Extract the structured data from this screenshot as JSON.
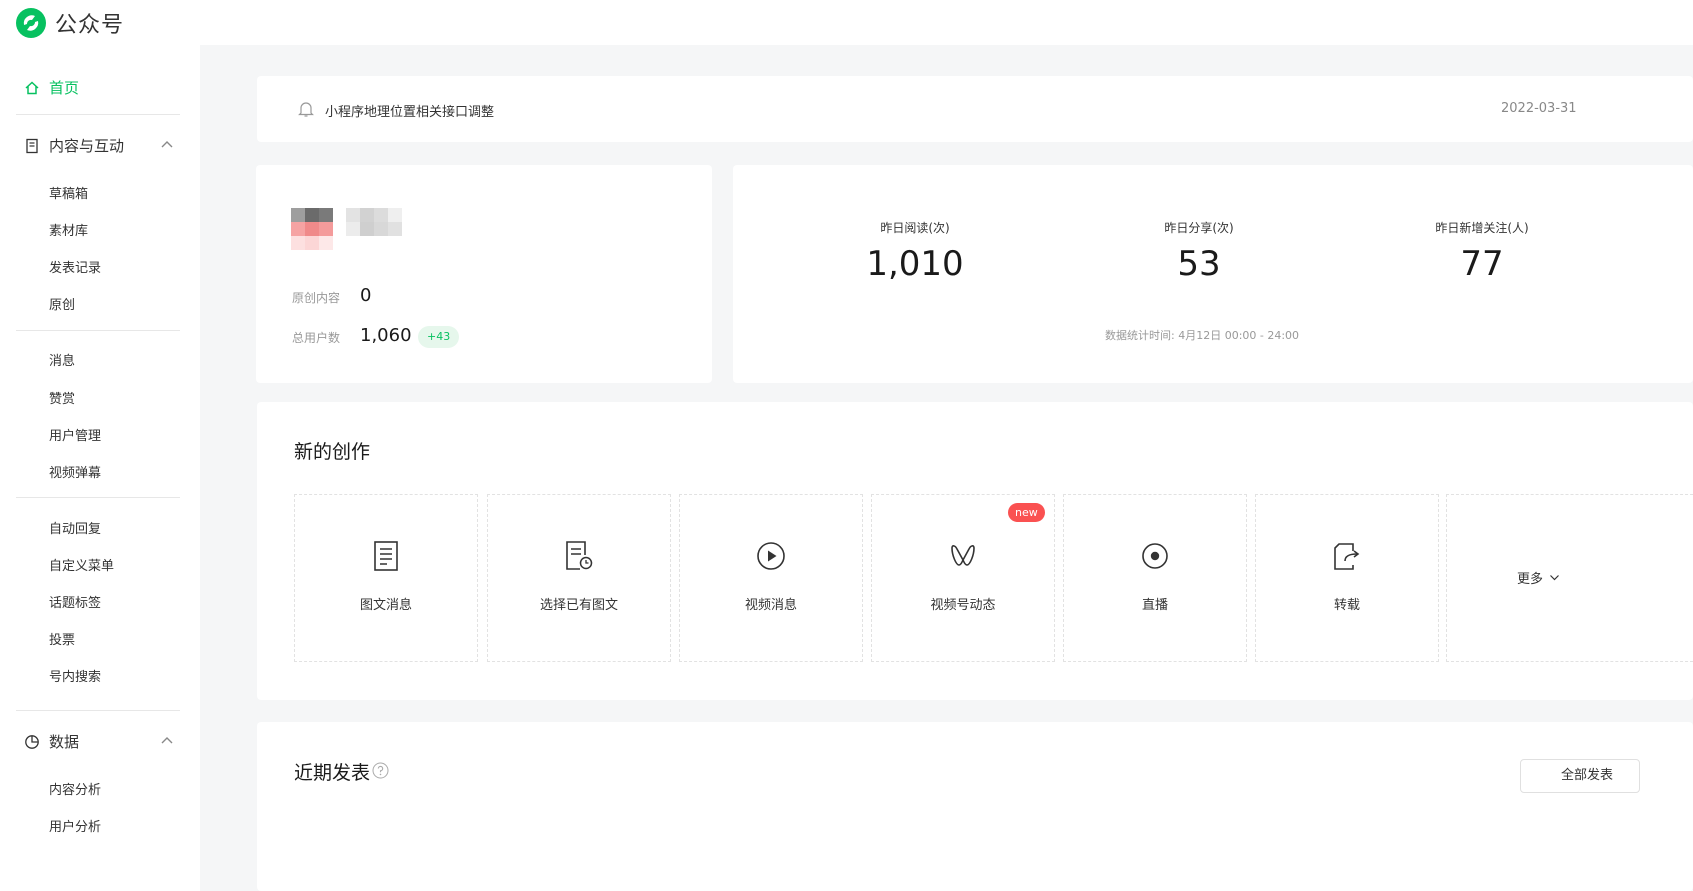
{
  "app": {
    "title": "公众号"
  },
  "sidebar": {
    "home": "首页",
    "groups": [
      {
        "title": "内容与互动",
        "items": [
          "草稿箱",
          "素材库",
          "发表记录",
          "原创",
          "消息",
          "赞赏",
          "用户管理",
          "视频弹幕",
          "自动回复",
          "自定义菜单",
          "话题标签",
          "投票",
          "号内搜索"
        ]
      },
      {
        "title": "数据",
        "items": [
          "内容分析",
          "用户分析"
        ]
      }
    ]
  },
  "notice": {
    "text": "小程序地理位置相关接口调整",
    "date": "2022-03-31"
  },
  "profile": {
    "original_label": "原创内容",
    "original_value": "0",
    "users_label": "总用户数",
    "users_value": "1,060",
    "users_delta": "+43"
  },
  "yesterday": {
    "metrics": [
      {
        "label": "昨日阅读(次)",
        "value": "1,010"
      },
      {
        "label": "昨日分享(次)",
        "value": "53"
      },
      {
        "label": "昨日新增关注(人)",
        "value": "77"
      }
    ],
    "time_note": "数据统计时间: 4月12日 00:00 - 24:00"
  },
  "create": {
    "title": "新的创作",
    "tiles": [
      {
        "label": "图文消息",
        "icon": "doc-icon"
      },
      {
        "label": "选择已有图文",
        "icon": "doc-clock-icon"
      },
      {
        "label": "视频消息",
        "icon": "play-circle-icon"
      },
      {
        "label": "视频号动态",
        "icon": "channels-icon",
        "badge": "new"
      },
      {
        "label": "直播",
        "icon": "live-icon"
      },
      {
        "label": "转载",
        "icon": "share-doc-icon"
      }
    ],
    "more": "更多"
  },
  "recent": {
    "title": "近期发表",
    "filter": "全部发表"
  },
  "colors": {
    "brand": "#07c160",
    "badge_red": "#fa5151"
  }
}
